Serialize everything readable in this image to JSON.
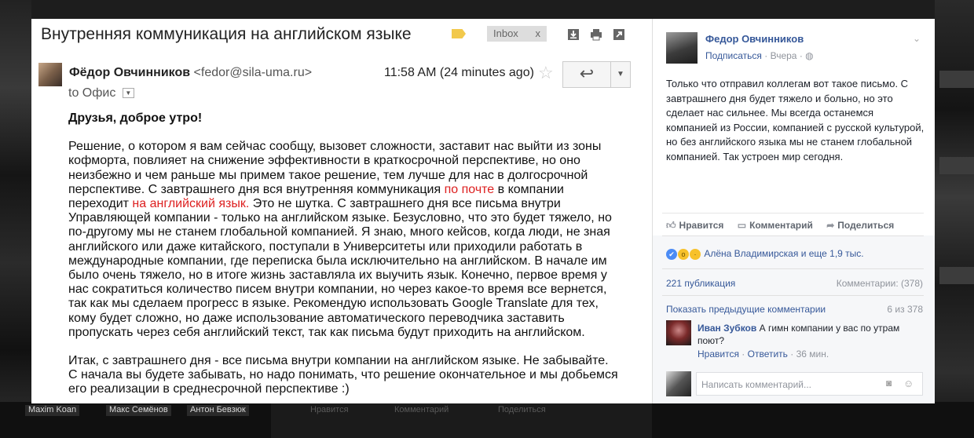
{
  "email": {
    "subject": "Внутренняя коммуникация на английском языке",
    "inbox_label": "Inbox",
    "inbox_close": "x",
    "sender_name": "Фёдор Овчинников",
    "sender_email": "<fedor@sila-uma.ru>",
    "time": "11:58 AM (24 minutes ago)",
    "to_prefix": "to",
    "to_name": "Офис",
    "greeting": "Друзья, доброе утро!",
    "p1_a": "Решение, о котором я вам сейчас сообщу, вызовет сложности, заставит нас выйти из зоны кофморта, повлияет на снижение эффективности в краткосрочной перспективе, но оно неизбежно и чем раньше мы примем такое решение, тем лучше для нас в долгосрочной перспективе. С завтрашнего дня вся внутренняя коммуникация ",
    "p1_red1": "по почте",
    "p1_b": " в компании переходит ",
    "p1_red2": "на английский язык.",
    "p1_c": " Это не шутка. С завтрашнего дня все письма внутри Управляющей компании - только на английском языке. Безусловно, что это будет тяжело, но по-другому мы не станем глобальной компанией. Я знаю, много кейсов, когда люди, не зная английского или даже китайского, поступали в Университеты или приходили работать в международные компании, где переписка была исключительно на английском. В начале им было очень тяжело, но в итоге жизнь заставляла их выучить язык. Конечно, первое время у нас сократиться количество писем внутри компании, но через какое-то время все вернется, так как мы сделаем прогресс в языке. Рекомендую использовать Google Translate для тех, кому будет сложно, но даже использование автоматического переводчика заставить пропускать через себя английский текст, так как письма будут приходить на английском.",
    "p2": "Итак, с завтрашнего дня - все письма внутри компании на английском языке. Не забывайте. С начала вы будете забывать, но надо понимать, что решение окончательное и мы добьемся его реализации в среднесрочной перспективе :)",
    "colors": {
      "highlight": "#dd1f1f",
      "label_tag": "#f2c94c"
    },
    "icons": [
      "label-icon",
      "archive-download-icon",
      "print-icon",
      "open-new-window-icon",
      "star-icon",
      "reply-icon",
      "dropdown-arrow-icon"
    ]
  },
  "post": {
    "author": "Федор Овчинников",
    "subscribe": "Подписаться",
    "separator": "·",
    "time": "Вчера",
    "audience_icon": "globe-icon",
    "text": "Только что отправил коллегам вот такое письмо. С завтрашнего дня будет тяжело и больно, но это сделает нас сильнее. Мы всегда останемся компанией из России, компанией с русской культурой, но без английского языка мы не станем глобальной компанией. Так устроен мир сегодня.",
    "actions": {
      "like": "Нравится",
      "comment": "Комментарий",
      "share": "Поделиться"
    },
    "reactions_text": "Алёна Владимирская и еще 1,9 тыс.",
    "shares": "221 публикация",
    "comments_count": "Комментарии: (378)",
    "show_prev": "Показать предыдущие комментарии",
    "shown_count": "6 из 378",
    "comment": {
      "author": "Иван Зубков",
      "text": "А гимн компании у вас по утрам поют?",
      "like": "Нравится",
      "reply": "Ответить",
      "time": "36 мин."
    },
    "write_placeholder": "Написать комментарий...",
    "colors": {
      "link": "#365899",
      "like_reaction": "#4c8cf5",
      "wow_reaction": "#f7c12b"
    }
  },
  "background": {
    "names": [
      "Maxim Koan",
      "Макс Семёнов",
      "Антон Бевзюк"
    ],
    "fb_actions": [
      "Нравится",
      "Комментарий",
      "Поделиться"
    ]
  }
}
